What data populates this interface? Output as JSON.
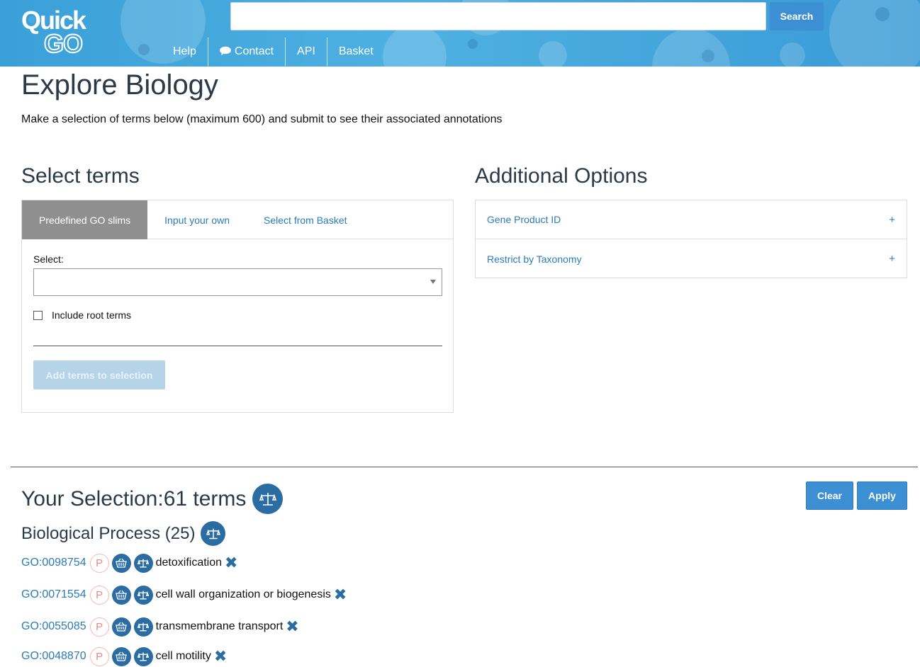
{
  "header": {
    "logo_text": "QuickGO",
    "search": {
      "placeholder": "",
      "button_label": "Search"
    },
    "nav": [
      {
        "label": "Help",
        "icon": ""
      },
      {
        "label": "Contact",
        "icon": "chat-icon"
      },
      {
        "label": "API",
        "icon": ""
      },
      {
        "label": "Basket",
        "icon": ""
      }
    ]
  },
  "page": {
    "title": "Explore Biology",
    "intro": "Make a selection of terms below (maximum 600) and submit to see their associated annotations"
  },
  "select_terms": {
    "title": "Select terms",
    "tabs": [
      "Predefined GO slims",
      "Input your own",
      "Select from Basket"
    ],
    "active_tab": "Predefined GO slims",
    "select_label": "Select:",
    "select_value": "",
    "include_root_label": "Include root terms",
    "include_root_checked": false,
    "add_button": "Add terms to selection"
  },
  "additional_options": {
    "title": "Additional Options",
    "rows": [
      {
        "label": "Gene Product ID",
        "toggle": "+"
      },
      {
        "label": "Restrict by Taxonomy",
        "toggle": "+"
      }
    ]
  },
  "selection": {
    "title_prefix": "Your Selection:",
    "count_text": "61 terms",
    "clear_label": "Clear",
    "apply_label": "Apply",
    "group_title": "Biological Process (25)",
    "terms": [
      {
        "id": "GO:0098754",
        "aspect": "P",
        "name": "detoxification"
      },
      {
        "id": "GO:0071554",
        "aspect": "P",
        "name": "cell wall organization or biogenesis"
      },
      {
        "id": "GO:0055085",
        "aspect": "P",
        "name": "transmembrane transport"
      },
      {
        "id": "GO:0048870",
        "aspect": "P",
        "name": "cell motility"
      }
    ]
  },
  "colors": {
    "header_blue": "#3aa0d8",
    "button_blue": "#3d8fd3",
    "icon_blue": "#2b6ca3",
    "link_blue": "#2a7bb8",
    "active_tab_gray": "#8f8f8f"
  }
}
